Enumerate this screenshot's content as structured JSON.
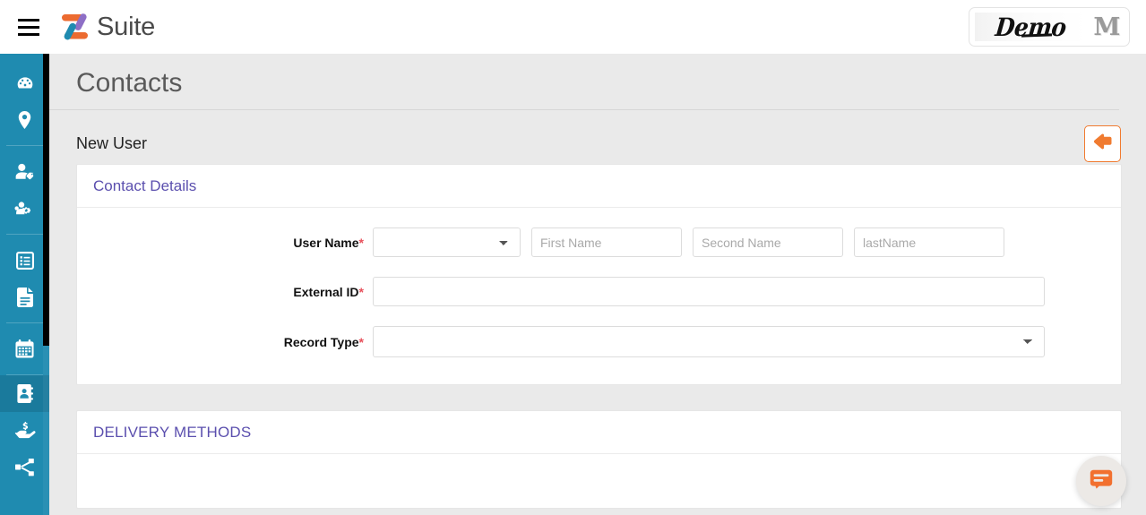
{
  "topbar": {
    "menu_icon": "hamburger-icon",
    "brand_name": "Suite",
    "brand_logo_icon": "z-logo-icon",
    "tenant_name": "Demo",
    "tenant_monogram": "M"
  },
  "sidebar": {
    "items": [
      {
        "icon": "dashboard-speedometer-icon",
        "active": false
      },
      {
        "icon": "location-pin-icon",
        "active": false
      },
      {
        "icon": "user-tag-icon",
        "active": false
      },
      {
        "icon": "users-cog-icon",
        "active": false
      },
      {
        "icon": "list-alt-icon",
        "active": false
      },
      {
        "icon": "file-document-icon",
        "active": false
      },
      {
        "icon": "calendar-icon",
        "active": false
      },
      {
        "icon": "address-book-icon",
        "active": true
      },
      {
        "icon": "hand-holding-dollar-icon",
        "active": false
      },
      {
        "icon": "sitemap-share-icon",
        "active": false
      }
    ]
  },
  "page": {
    "title": "Contacts",
    "subtitle": "New User",
    "back_button_icon": "arrow-left-icon"
  },
  "contact_details": {
    "heading": "Contact Details",
    "fields": {
      "user_name": {
        "label": "User Name",
        "required": true,
        "salutation": {
          "value": "",
          "placeholder": ""
        },
        "first_name": {
          "value": "",
          "placeholder": "First Name"
        },
        "second_name": {
          "value": "",
          "placeholder": "Second Name"
        },
        "last_name": {
          "value": "",
          "placeholder": "lastName"
        }
      },
      "external_id": {
        "label": "External ID",
        "required": true,
        "value": "",
        "placeholder": ""
      },
      "record_type": {
        "label": "Record Type",
        "required": true,
        "value": "",
        "placeholder": ""
      }
    }
  },
  "delivery_methods": {
    "heading": "DELIVERY METHODS"
  },
  "chat": {
    "icon": "chat-bubble-icon"
  },
  "colors": {
    "sidebar": "#1f8bb0",
    "sidebar_active": "#1a7a9c",
    "accent_orange": "#f07b30",
    "heading_purple": "#5b4fae",
    "required_red": "#e8505b",
    "page_background": "#eaeaea"
  }
}
